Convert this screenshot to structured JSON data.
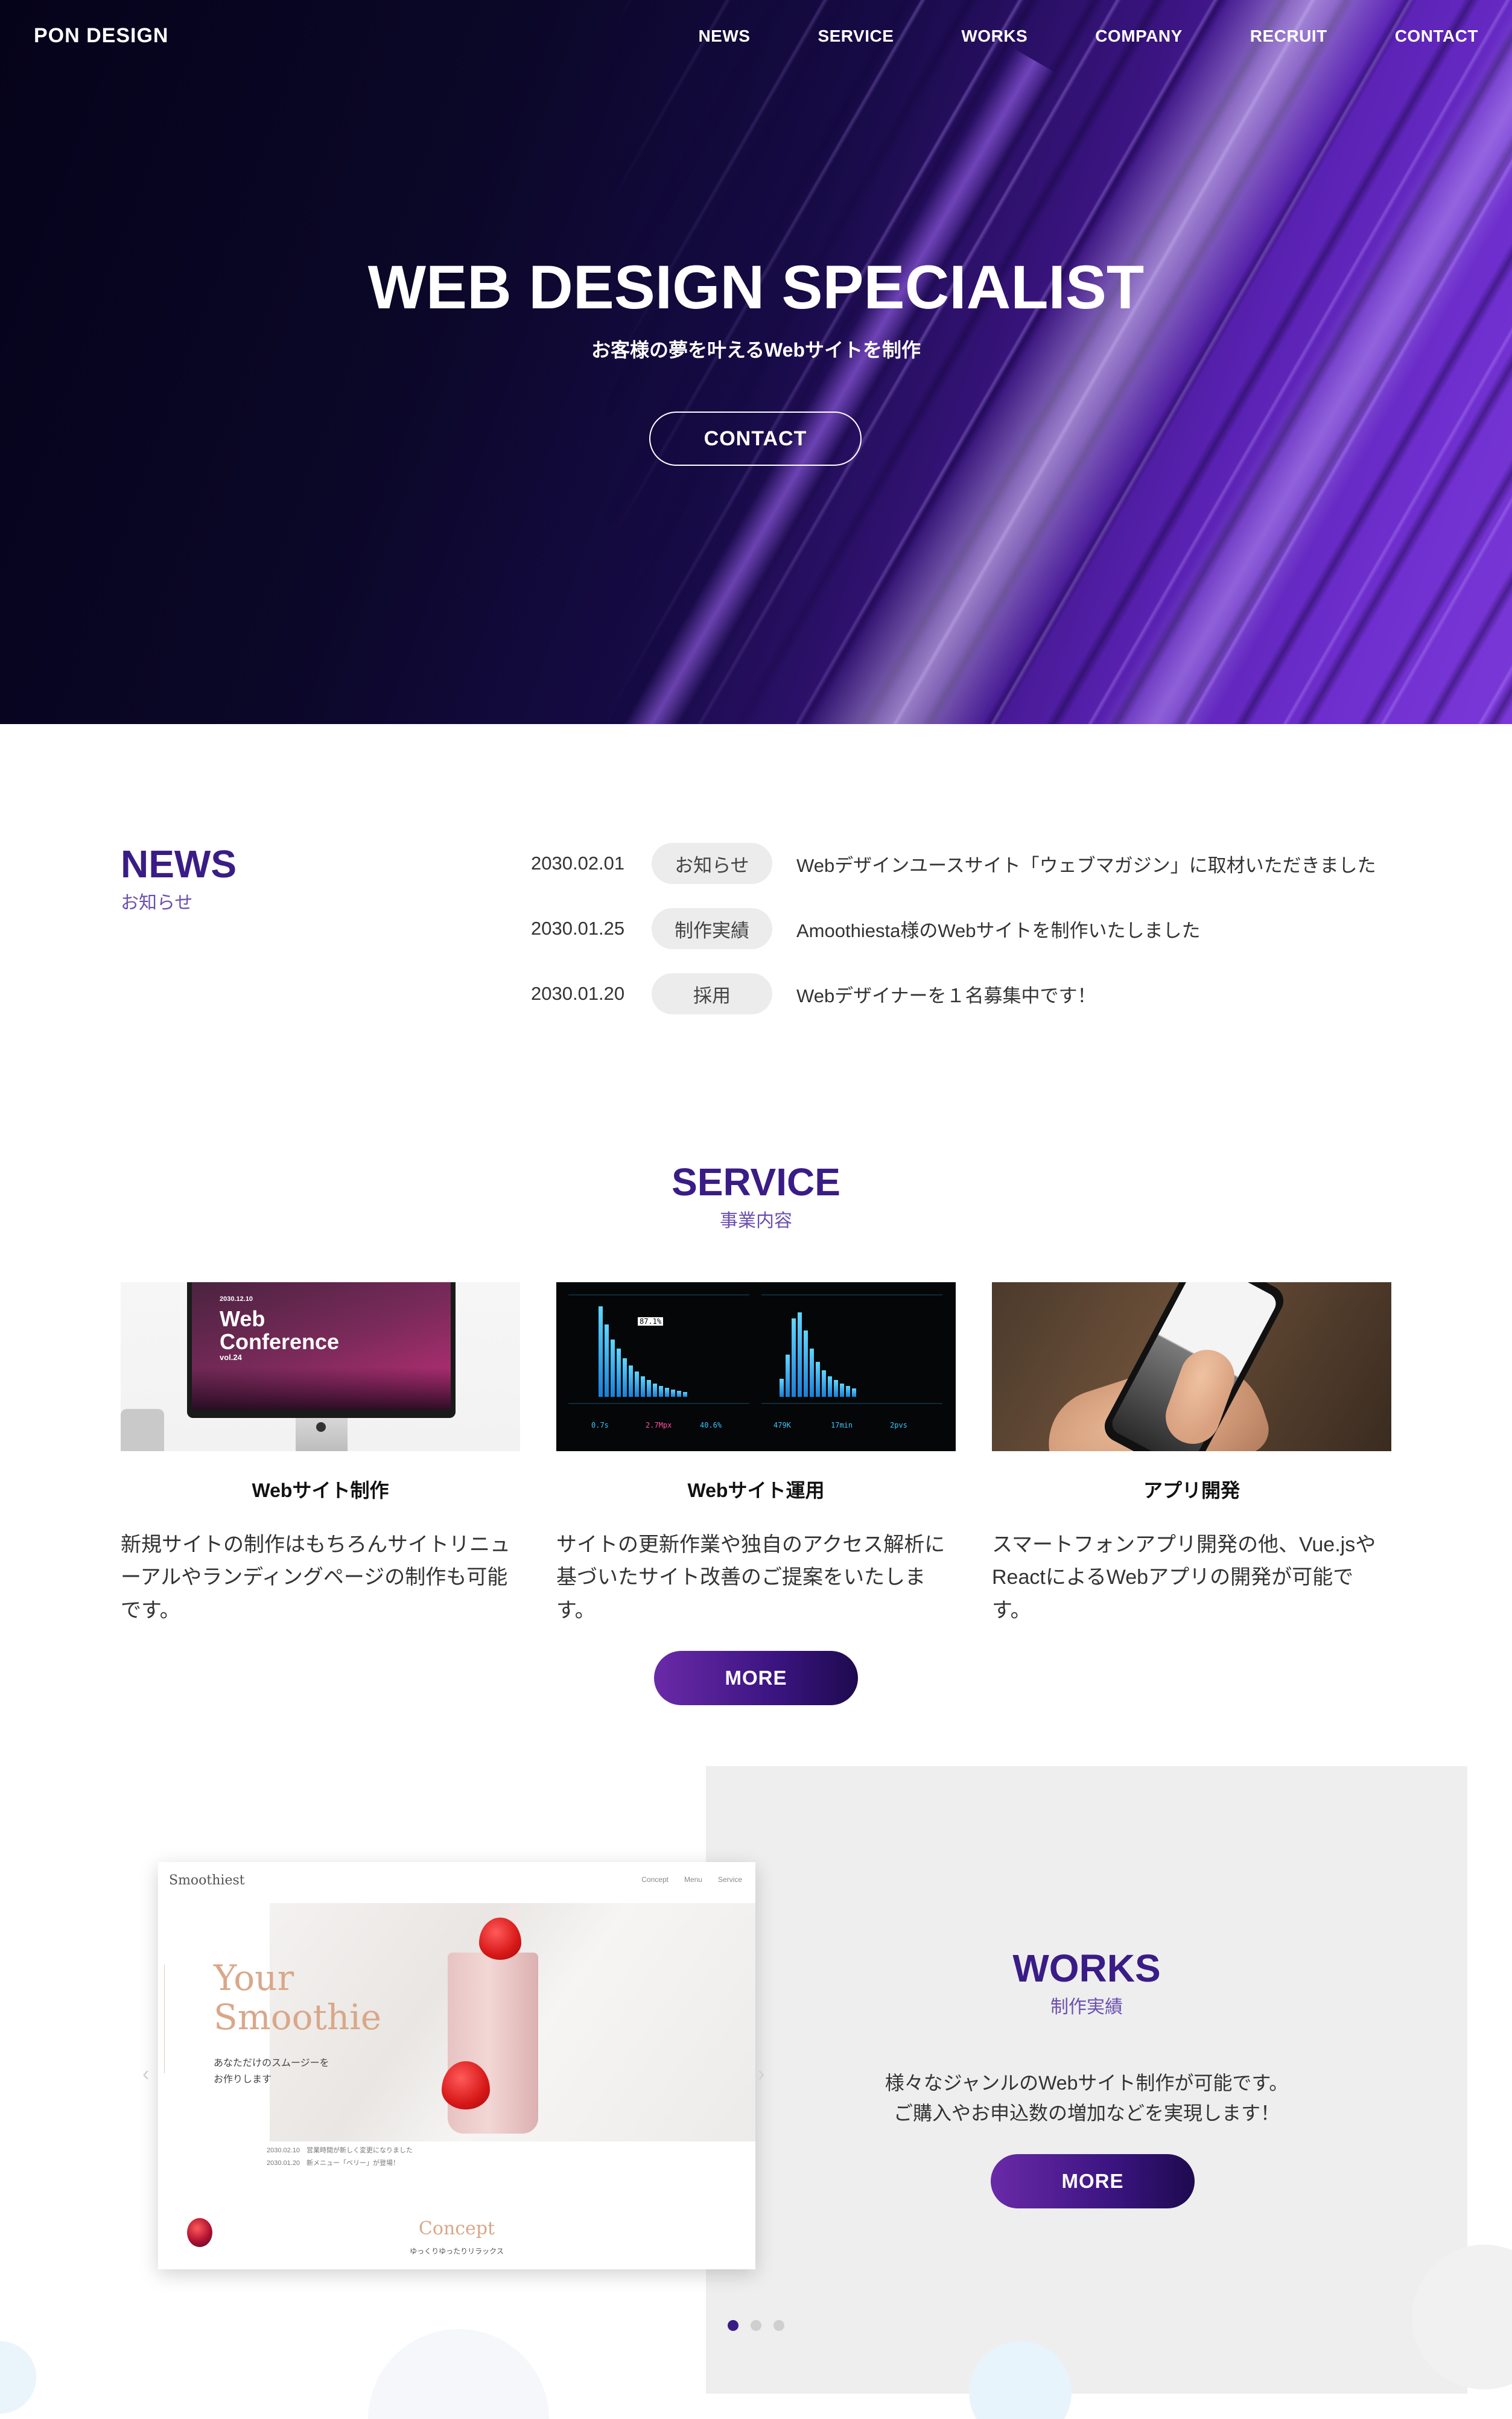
{
  "site": {
    "logo": "PON DESIGN"
  },
  "nav": [
    {
      "label": "NEWS"
    },
    {
      "label": "SERVICE"
    },
    {
      "label": "WORKS"
    },
    {
      "label": "COMPANY"
    },
    {
      "label": "RECRUIT"
    },
    {
      "label": "CONTACT"
    }
  ],
  "hero": {
    "title": "WEB DESIGN SPECIALIST",
    "subtitle": "お客様の夢を叶えるWebサイトを制作",
    "button": "CONTACT"
  },
  "news": {
    "title": "NEWS",
    "subtitle": "お知らせ",
    "items": [
      {
        "date": "2030.02.01",
        "category": "お知らせ",
        "text": "Webデザインユースサイト「ウェブマガジン」に取材いただきました"
      },
      {
        "date": "2030.01.25",
        "category": "制作実績",
        "text": "Amoothiesta様のWebサイトを制作いたしました"
      },
      {
        "date": "2030.01.20",
        "category": "採用",
        "text": "Webデザイナーを１名募集中です！"
      }
    ]
  },
  "service": {
    "title": "SERVICE",
    "subtitle": "事業内容",
    "cards": [
      {
        "title": "Webサイト制作",
        "text": "新規サイトの制作はもちろんサイトリニューアルやランディングページの制作も可能です。",
        "image_text": {
          "date": "2030.12.10",
          "line1": "Web",
          "line2": "Conference",
          "line3": "vol.24"
        }
      },
      {
        "title": "Webサイト運用",
        "text": "サイトの更新作業や独自のアクセス解析に基づいたサイト改善のご提案をいたします。",
        "image_text": {
          "stat1": "0.7s",
          "stat2": "2.7Mpx",
          "stat3": "40.6%",
          "stat4": "479K",
          "stat5": "17min",
          "stat6": "2pvs",
          "badge": "87.1%"
        }
      },
      {
        "title": "アプリ開発",
        "text": "スマートフォンアプリ開発の他、Vue.jsやReactによるWebアプリの開発が可能です。"
      }
    ],
    "more": "MORE"
  },
  "works": {
    "title": "WORKS",
    "subtitle": "制作実績",
    "text_line1": "様々なジャンルのWebサイト制作が可能です。",
    "text_line2": "ご購入やお申込数の増加などを実現します！",
    "more": "MORE",
    "mockup": {
      "logo": "Smoothiest",
      "nav": [
        "Concept",
        "Menu",
        "Service"
      ],
      "title_line1": "Your",
      "title_line2": "Smoothie",
      "copy_line1": "あなただけのスムージーを",
      "copy_line2": "お作りします",
      "news_line1": "2030.02.10　営業時間が新しく変更になりました",
      "news_line2": "2030.01.20　新メニュー「ベリー」が登場！",
      "concept": "Concept",
      "concept_sub": "ゆっくりゆったりリラックス"
    },
    "carousel": {
      "slides": 3,
      "active": 1
    }
  },
  "colors": {
    "brand": "#3a1c86",
    "accent_gradient_start": "#6a2aa8",
    "accent_gradient_end": "#1e0a4f",
    "pill_bg": "#ececec"
  }
}
